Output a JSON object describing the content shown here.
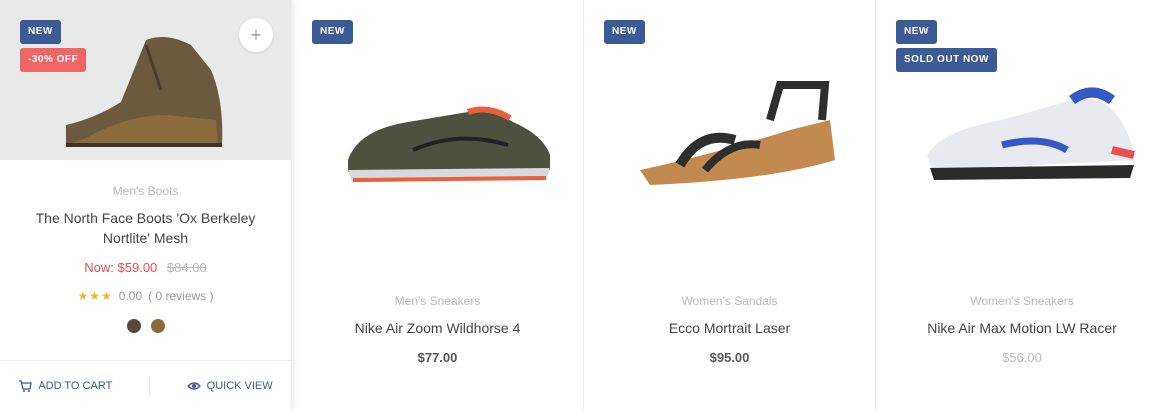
{
  "products": [
    {
      "badges": [
        "NEW",
        "-30% OFF"
      ],
      "category": "Men's Boots",
      "name": "The North Face Boots 'Ox Berkeley Nortlite' Mesh",
      "sale_price": "Now: $59.00",
      "old_price": "$84.00",
      "stars": "★★★",
      "rating_value": "0.00",
      "reviews": "( 0 reviews )",
      "swatch_colors": [
        "#5a4a3a",
        "#8a6a3a"
      ],
      "add_to_cart": "ADD TO CART",
      "quick_view": "QUICK VIEW",
      "image": "shoe-boot-image"
    },
    {
      "badges": [
        "NEW"
      ],
      "category": "Men's Sneakers",
      "name": "Nike Air Zoom Wildhorse 4",
      "price": "$77.00",
      "image": "shoe-runner-image"
    },
    {
      "badges": [
        "NEW"
      ],
      "category": "Women's Sandals",
      "name": "Ecco Mortrait Laser",
      "price": "$95.00",
      "image": "shoe-sandal-image"
    },
    {
      "badges": [
        "NEW",
        "SOLD OUT NOW"
      ],
      "category": "Women's Sneakers",
      "name": "Nike Air Max Motion LW Racer",
      "price": "$56.00",
      "image": "shoe-sneaker-image"
    }
  ],
  "colors": {
    "new_badge": "#3c5a93",
    "sale_badge": "#f06565",
    "sale_price": "#e94f4f",
    "star": "#f5b623"
  }
}
